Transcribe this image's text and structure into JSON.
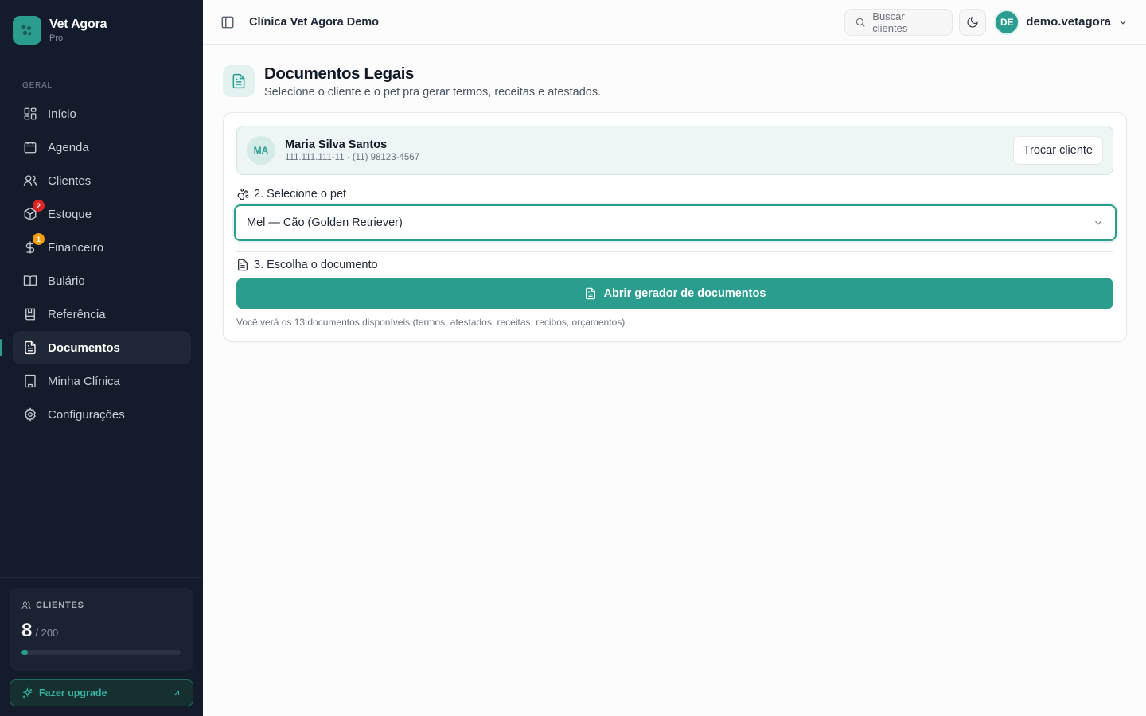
{
  "brand": {
    "name": "Vet Agora",
    "plan": "Pro"
  },
  "sidebar": {
    "section_label": "GERAL",
    "items": [
      {
        "label": "Início",
        "icon": "grid-icon"
      },
      {
        "label": "Agenda",
        "icon": "calendar-icon"
      },
      {
        "label": "Clientes",
        "icon": "users-icon"
      },
      {
        "label": "Estoque",
        "icon": "package-icon",
        "badge": "2",
        "badge_color": "#dc2626"
      },
      {
        "label": "Financeiro",
        "icon": "dollar-icon",
        "badge": "1",
        "badge_color": "#f59e0b"
      },
      {
        "label": "Bulário",
        "icon": "book-open-icon"
      },
      {
        "label": "Referência",
        "icon": "book-icon"
      },
      {
        "label": "Documentos",
        "icon": "file-text-icon",
        "active": true
      },
      {
        "label": "Minha Clínica",
        "icon": "building-icon"
      },
      {
        "label": "Configurações",
        "icon": "gear-icon"
      }
    ],
    "clients_card": {
      "label": "CLIENTES",
      "count": "8",
      "limit": "/ 200",
      "usage_fraction": 0.04
    },
    "upgrade_label": "Fazer upgrade"
  },
  "topbar": {
    "clinic_name": "Clínica Vet Agora Demo",
    "search_placeholder": "Buscar clientes",
    "user_initials": "DE",
    "user_name": "demo.vetagora"
  },
  "page": {
    "title": "Documentos Legais",
    "subtitle": "Selecione o cliente e o pet pra gerar termos, receitas e atestados."
  },
  "client": {
    "initials": "MA",
    "name": "Maria Silva Santos",
    "meta": "111.111.111-11 · (11) 98123-4567",
    "swap_label": "Trocar cliente"
  },
  "pet_step": {
    "label": "2. Selecione o pet",
    "selected": "Mel — Cão (Golden Retriever)"
  },
  "doc_step": {
    "label": "3. Escolha o documento",
    "button_label": "Abrir gerador de documentos",
    "hint": "Você verá os 13 documentos disponíveis (termos, atestados, receitas, recibos, orçamentos)."
  },
  "colors": {
    "accent": "#2a9d8f",
    "sidebar_bg": "#141b2b"
  }
}
